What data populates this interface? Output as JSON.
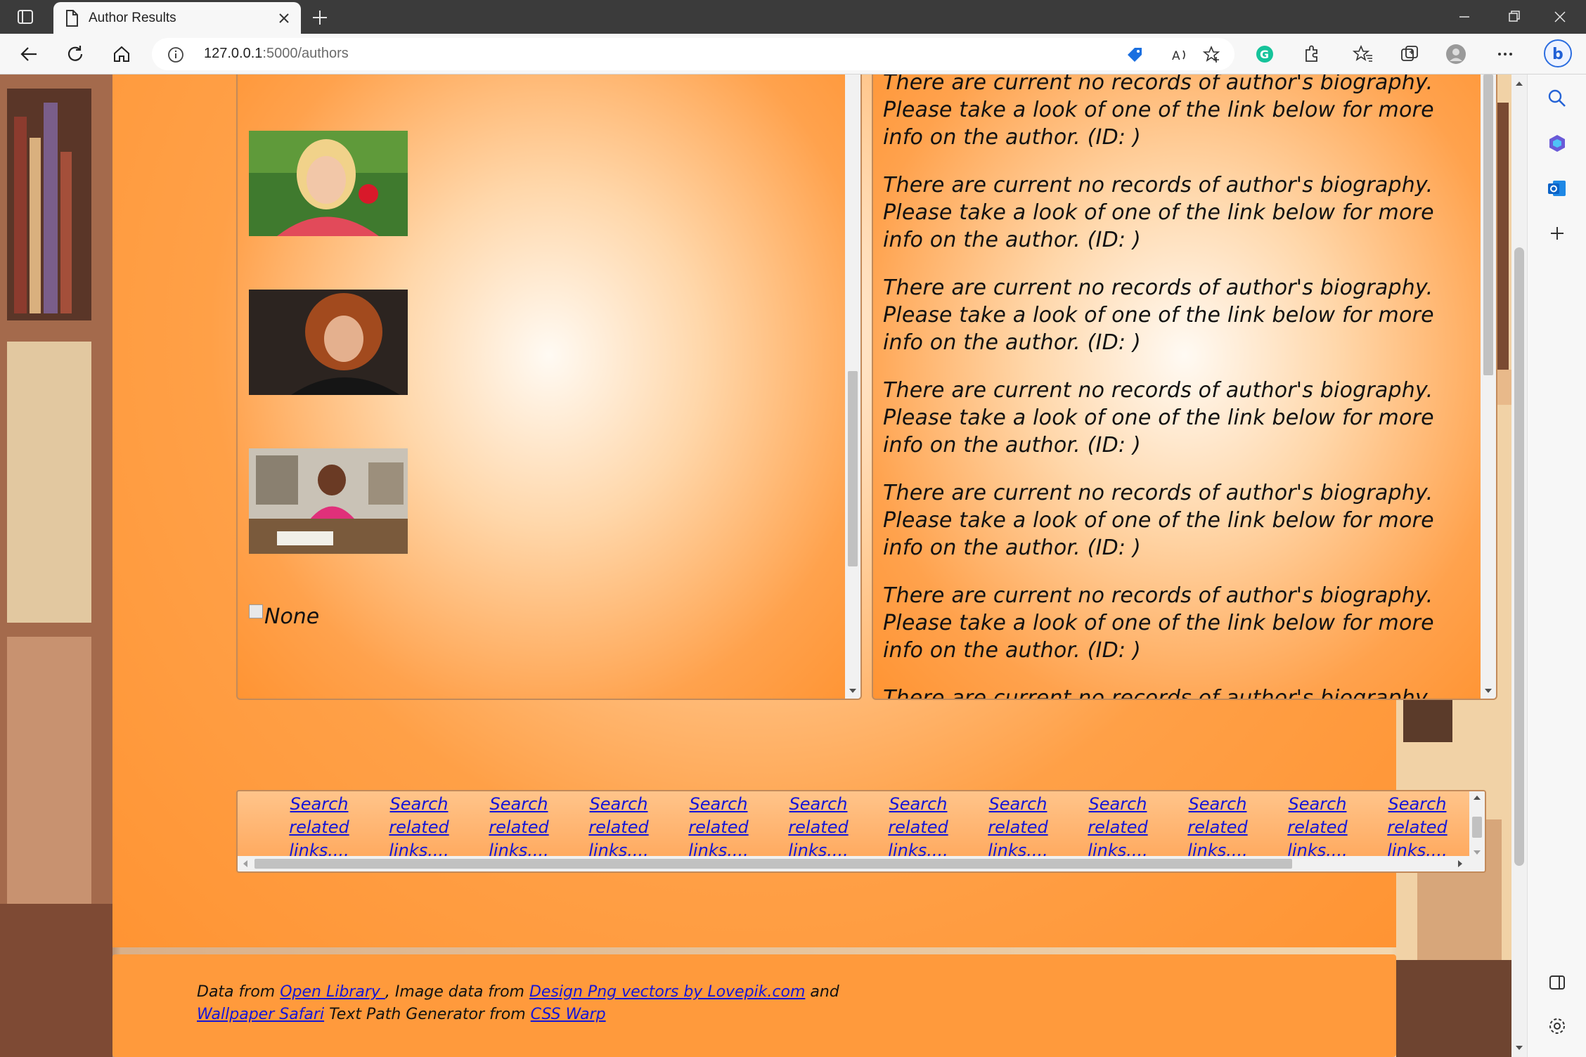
{
  "browser": {
    "tab_title": "Author Results",
    "url_host": "127.0.0.1",
    "url_path": ":5000/authors"
  },
  "authors": {
    "photos": [
      {
        "alt": "author-photo-1"
      },
      {
        "alt": "author-photo-2"
      },
      {
        "alt": "author-photo-3"
      }
    ],
    "missing_photo_text": "None"
  },
  "bios": [
    "There are current no records of author's biography. Please take a look of one of the link below for more info on the author. (ID: )",
    "There are current no records of author's biography. Please take a look of one of the link below for more info on the author. (ID: )",
    "There are current no records of author's biography. Please take a look of one of the link below for more info on the author. (ID: )",
    "There are current no records of author's biography. Please take a look of one of the link below for more info on the author. (ID: )",
    "There are current no records of author's biography. Please take a look of one of the link below for more info on the author. (ID: )",
    "There are current no records of author's biography. Please take a look of one of the link below for more info on the author. (ID: )",
    "There are current no records of author's biography. Please take a look of one of the link below for more info on the author. (ID: )"
  ],
  "links": [
    "Search related links....",
    "Search related links....",
    "Search related links....",
    "Search related links....",
    "Search related links....",
    "Search related links....",
    "Search related links....",
    "Search related links....",
    "Search related links....",
    "Search related links....",
    "Search related links....",
    "Search related links...."
  ],
  "footer": {
    "prefix": "Data from ",
    "open_library": "Open Library ",
    "image_data": ", Image data from ",
    "lovepik": "Design Png vectors by Lovepik.com",
    "and": " and ",
    "wallpaper": "Wallpaper Safari",
    "text_path": " Text Path Generator from ",
    "css_warp": "CSS Warp"
  },
  "colors": {
    "panel_orange": "#ff9433",
    "link_blue": "#1515d8",
    "titlebar": "#3b3b3b"
  }
}
